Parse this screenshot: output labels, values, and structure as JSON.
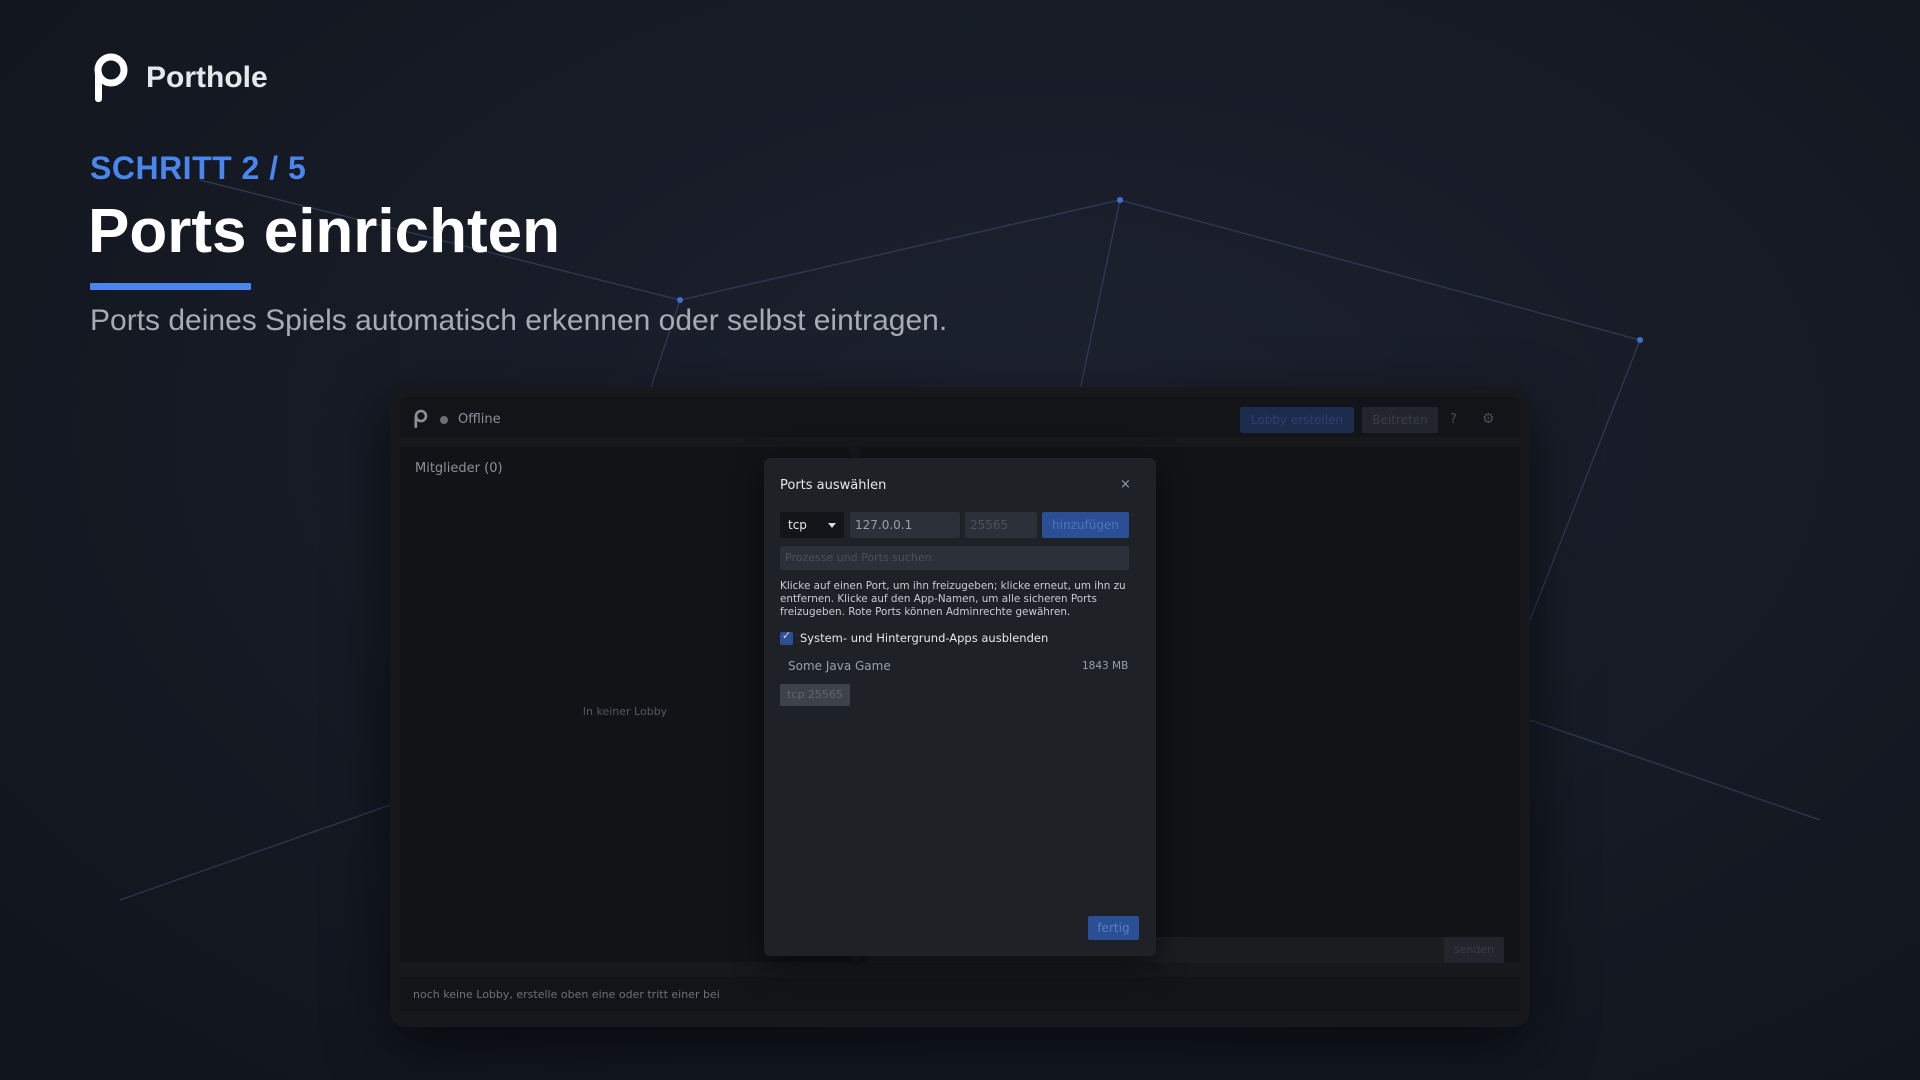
{
  "brand": {
    "name": "Porthole",
    "logo_icon": "porthole-logo-icon"
  },
  "heading": {
    "step": "SCHRITT 2 / 5",
    "title": "Ports einrichten",
    "subtitle": "Ports deines Spiels automatisch erkennen oder selbst eintragen."
  },
  "colors": {
    "accent": "#4a86ee",
    "button_blue": "#2b4f95"
  },
  "app": {
    "status": "Offline",
    "topbar": {
      "create_lobby": "Lobby erstellen",
      "join": "Beitreten",
      "help": "?",
      "settings_icon": "gear-icon"
    },
    "members": {
      "title": "Mitglieder (0)",
      "empty": "In keiner Lobby"
    },
    "chat": {
      "send": "senden"
    },
    "footer": "noch keine Lobby, erstelle oben eine oder tritt einer bei"
  },
  "modal": {
    "title": "Ports auswählen",
    "close": "×",
    "protocol": "tcp",
    "ip": "127.0.0.1",
    "port_placeholder": "25565",
    "add": "hinzufügen",
    "search_placeholder": "Prozesse und Ports suchen",
    "help": "Klicke auf einen Port, um ihn freizugeben; klicke erneut, um ihn zu entfernen. Klicke auf den App-Namen, um alle sicheren Ports freizugeben. Rote Ports können Adminrechte gewähren.",
    "hide_system_label": "System- und Hintergrund-Apps ausblenden",
    "hide_system_checked": true,
    "process": {
      "name": "Some Java Game",
      "memory": "1843 MB",
      "ports": [
        "tcp 25565"
      ]
    },
    "done": "fertig"
  }
}
